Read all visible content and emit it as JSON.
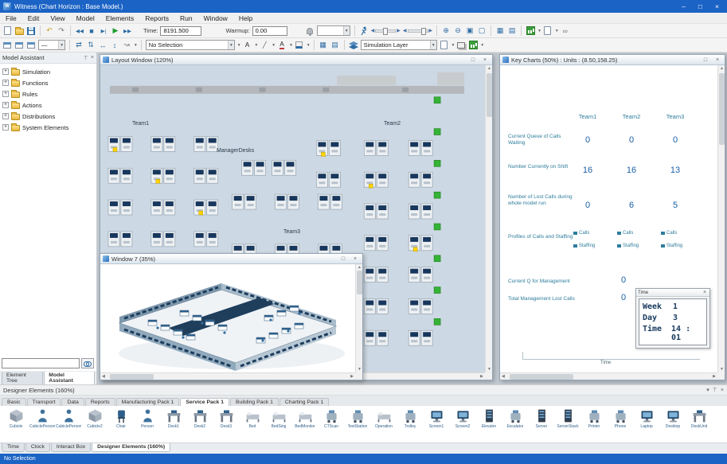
{
  "window": {
    "title": "Witness (Chart Horizon : Base Model.)"
  },
  "icons": {
    "minimize": "–",
    "maximize": "□",
    "close": "×",
    "dropdown": "▾",
    "undo": "↶",
    "redo": "↷",
    "seek_start": "◀◀",
    "stop": "■",
    "step": "▶|",
    "run": "▶",
    "fast_forward": "▶▶",
    "left": "◀",
    "right": "▶",
    "up": "▲",
    "down": "▼",
    "zoom_in": "⊕",
    "zoom_out": "⊖",
    "zoom_fit": "▣",
    "zoom_window": "▢",
    "grid": "▦",
    "snap": "▤",
    "swap_h": "⇄",
    "swap_v": "⇅",
    "arrow_h": "↔",
    "arrow_v": "↕",
    "route": "↝",
    "font": "A",
    "pen": "╱",
    "dash": "—",
    "plus": "+",
    "pin": "⊤",
    "link": "∞"
  },
  "menu": {
    "items": [
      "File",
      "Edit",
      "View",
      "Model",
      "Elements",
      "Reports",
      "Run",
      "Window",
      "Help"
    ]
  },
  "toolbar": {
    "time_label": "Time:",
    "time_value": "8191.500",
    "warmup_label": "Warmup:",
    "warmup_value": "0.00",
    "selection_value": "No Selection",
    "layer_value": "Simulation Layer"
  },
  "model_assistant": {
    "title": "Model Assistant",
    "items": [
      "Simulation",
      "Functions",
      "Rules",
      "Actions",
      "Distributions",
      "System Elements"
    ],
    "tabs": [
      "Element Tree",
      "Model Assistant"
    ]
  },
  "layout_window": {
    "title": "Layout Window (120%)",
    "labels": {
      "team1": "Team1",
      "team2": "Team2",
      "team3": "Team3",
      "manager": "ManagerDesks"
    }
  },
  "window7": {
    "title": "Window 7 (35%)"
  },
  "key_charts": {
    "title": "Key Charts (50%) : Units : (8.50,158.25)",
    "columns": [
      "Team1",
      "Team2",
      "Team3"
    ],
    "rows": [
      {
        "label": "Current Queue of Calls Waiting",
        "values": [
          "0",
          "0",
          "0"
        ]
      },
      {
        "label": "Number Currently on Shift",
        "values": [
          "16",
          "16",
          "13"
        ]
      },
      {
        "label": "Number of Lost Calls during whole model run",
        "values": [
          "0",
          "6",
          "5"
        ]
      }
    ],
    "profiles_label": "Profiles of Calls and Staffing",
    "legend": {
      "calls": "Calls",
      "staffing": "Staffing"
    },
    "management": [
      {
        "label": "Current Q for Management",
        "value": "0"
      },
      {
        "label": "Total Management Lost Calls",
        "value": "0"
      }
    ],
    "axis_label": "Time",
    "time_box": {
      "title": "Time",
      "rows": [
        {
          "label": "Week",
          "value": "1"
        },
        {
          "label": "Day",
          "value": "3"
        },
        {
          "label": "Time",
          "value": "14 : 01"
        }
      ]
    }
  },
  "designer_elements": {
    "title": "Designer Elements (160%)",
    "tabs": [
      "Basic",
      "Transport",
      "Data",
      "Reports",
      "Manufacturing Pack 1",
      "Service Pack 1",
      "Building Pack 1",
      "Charting Pack 1"
    ],
    "active_tab": "Service Pack 1",
    "items": [
      {
        "label": "Cubicle"
      },
      {
        "label": "CubiclePerson"
      },
      {
        "label": "CubiclePerson2"
      },
      {
        "label": "Cubicle2"
      },
      {
        "label": "Chair"
      },
      {
        "label": "Person"
      },
      {
        "label": "Desk1"
      },
      {
        "label": "Desk2"
      },
      {
        "label": "Desk3"
      },
      {
        "label": "Bed"
      },
      {
        "label": "BedSing"
      },
      {
        "label": "BedMonitor"
      },
      {
        "label": "CTScan"
      },
      {
        "label": "TestStation"
      },
      {
        "label": "Operation"
      },
      {
        "label": "Trolley"
      },
      {
        "label": "Screen1"
      },
      {
        "label": "Screen2"
      },
      {
        "label": "Elevator"
      },
      {
        "label": "Escalator"
      },
      {
        "label": "Server"
      },
      {
        "label": "ServerStack"
      },
      {
        "label": "Printer"
      },
      {
        "label": "Phone"
      },
      {
        "label": "Laptop"
      },
      {
        "label": "Desktop"
      },
      {
        "label": "DeskUnit"
      }
    ]
  },
  "bottom_tabs": {
    "items": [
      "Time",
      "Clock",
      "Interact Box",
      "Designer Elements (160%)"
    ],
    "active": "Designer Elements (160%)"
  },
  "status_bar": {
    "text": "No Selection"
  },
  "colors": {
    "accent": "#1b63c5",
    "run_green": "#1f9d2f",
    "chart_teal": "#2e7d9c",
    "value_blue": "#1a5fa8",
    "floor_bg": "#ccd8e3"
  }
}
